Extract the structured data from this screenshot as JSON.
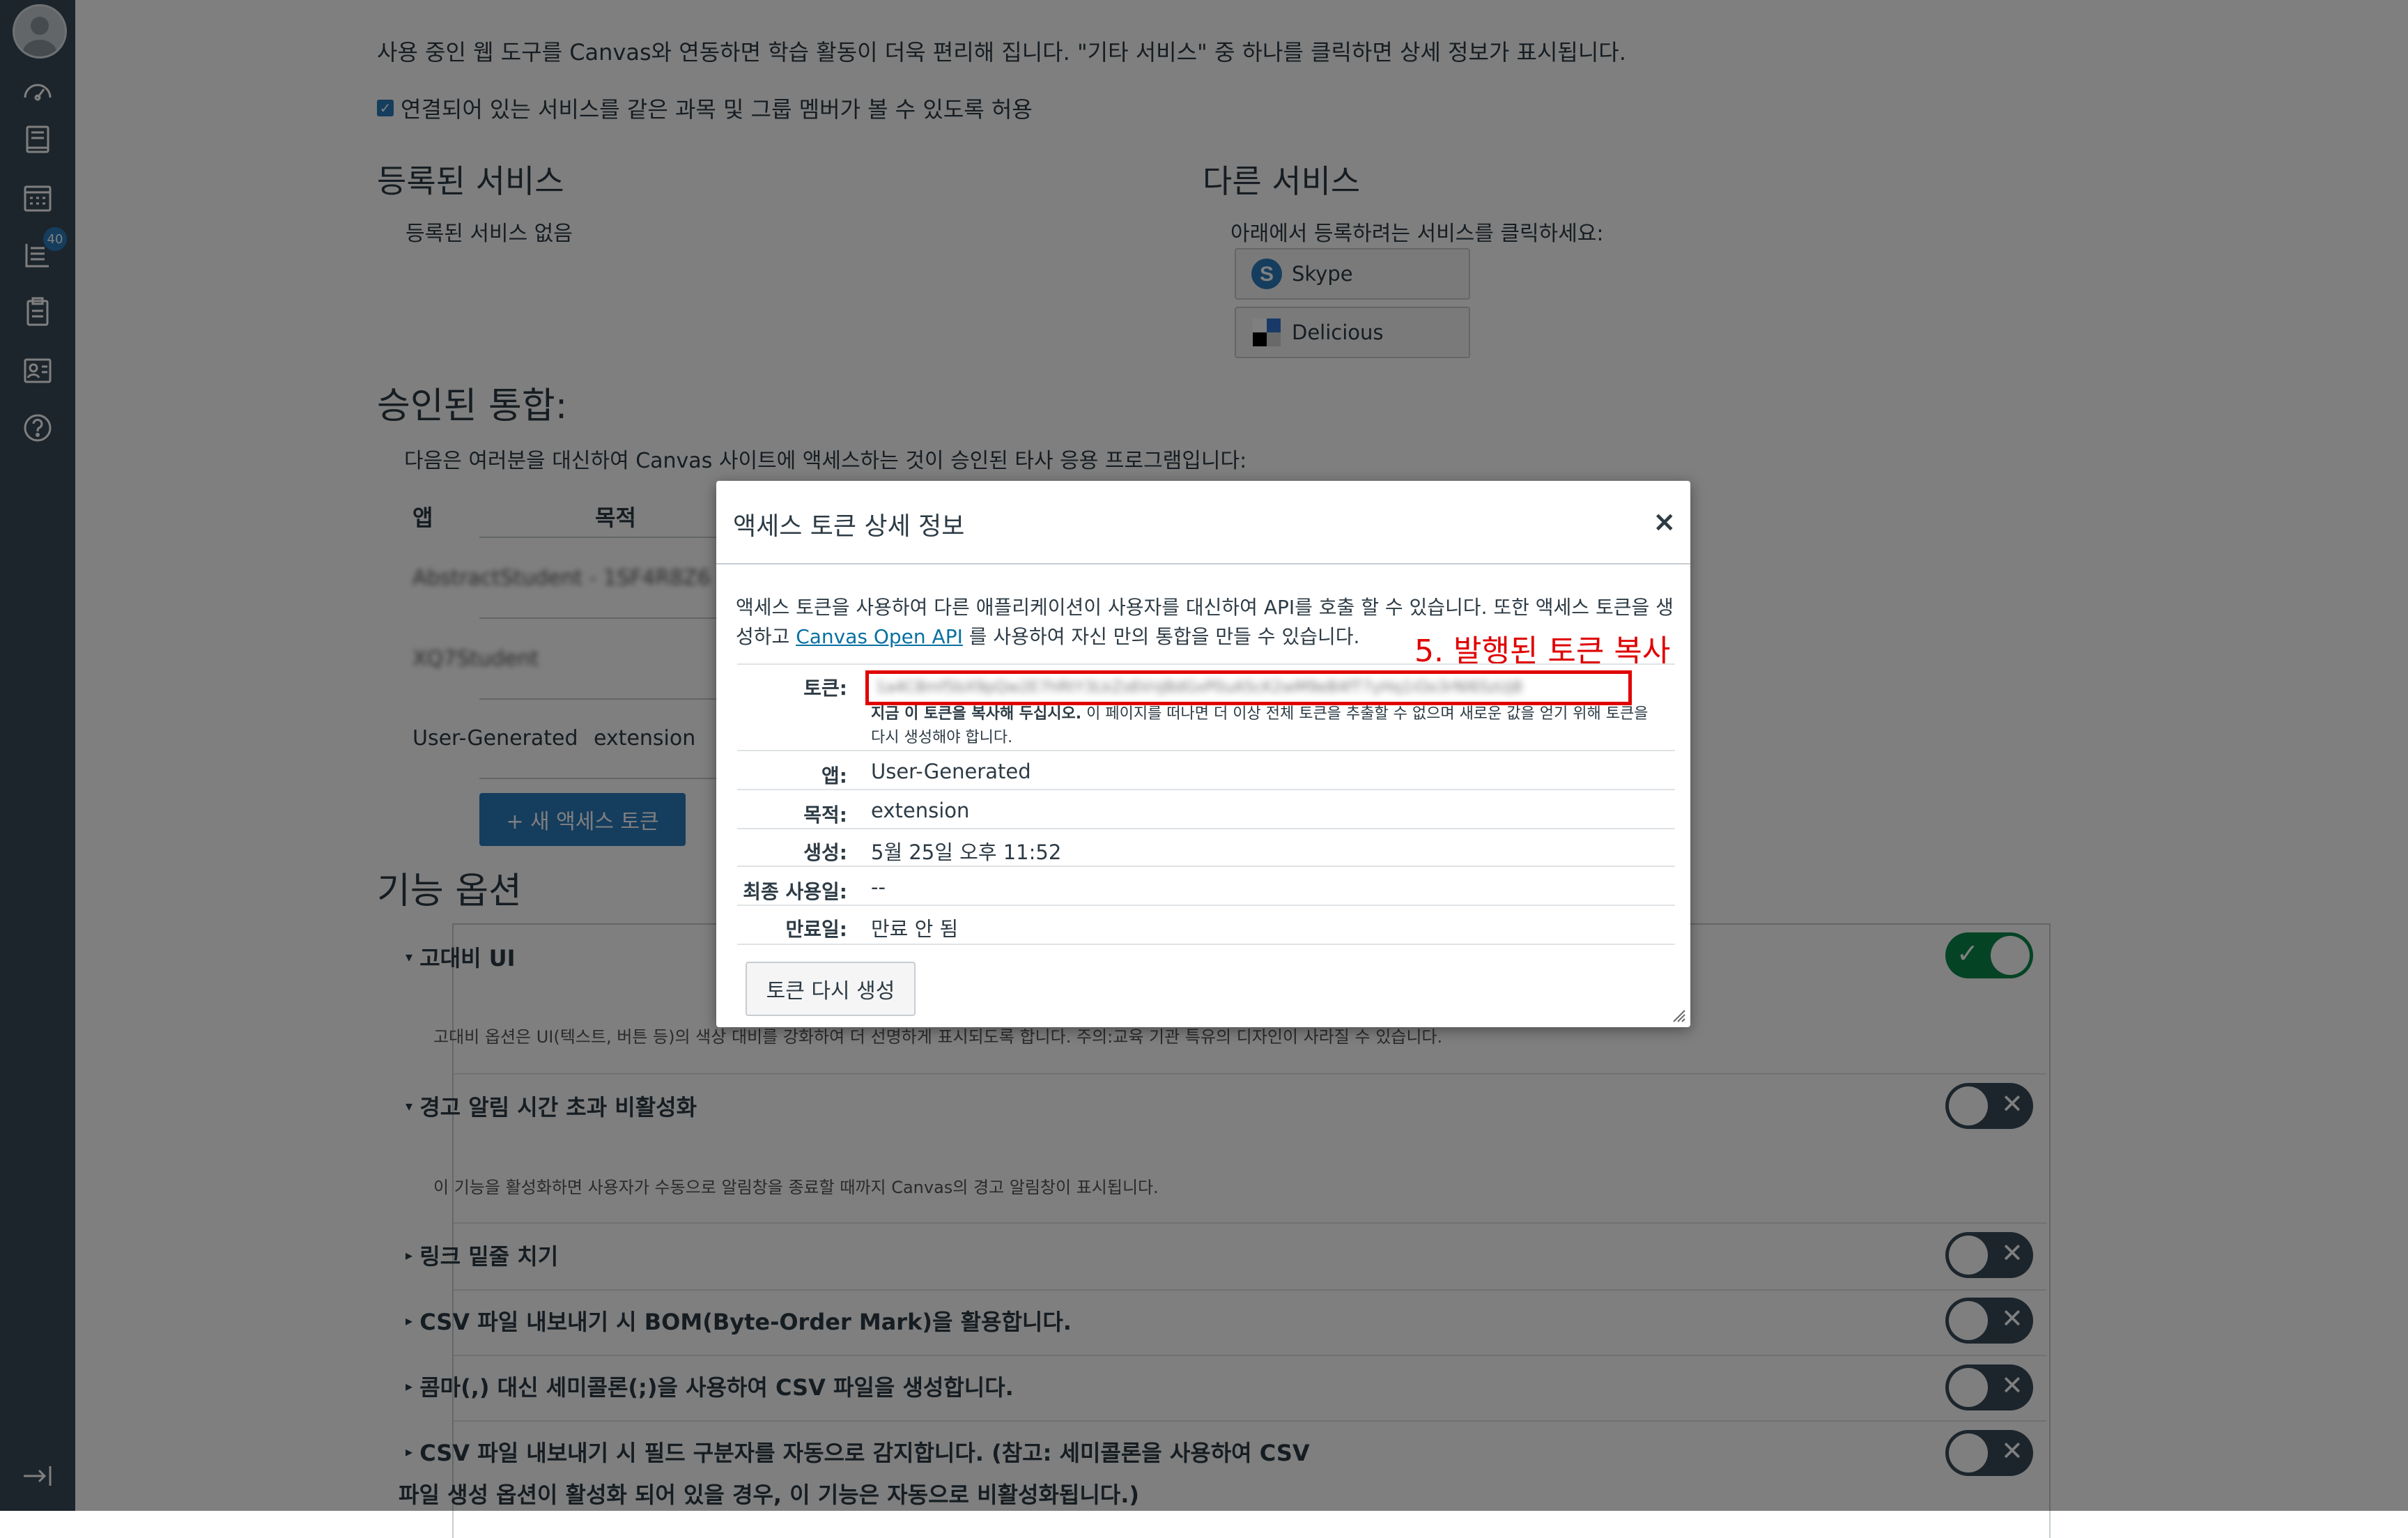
{
  "main": {
    "intro_text": "사용 중인 웹 도구를 Canvas와 연동하면 학습 활동이 더욱 편리해 집니다. \"기타 서비스\" 중 하나를 클릭하면 상세 정보가 표시됩니다.",
    "allow_checkbox_label": "연결되어 있는 서비스를 같은 과목 및 그룹 멤버가 볼 수 있도록 허용",
    "registered_services": {
      "title": "등록된 서비스",
      "empty_text": "등록된 서비스 없음"
    },
    "other_services": {
      "title": "다른 서비스",
      "instruction": "아래에서 등록하려는 서비스를 클릭하세요:",
      "items": [
        "Skype",
        "Delicious"
      ]
    },
    "approved": {
      "title": "승인된 통합:",
      "description": "다음은 여러분을 대신하여 Canvas 사이트에 액세스하는 것이 승인된 타사 응용 프로그램입니다:",
      "columns": [
        "앱",
        "목적"
      ],
      "rows": [
        {
          "app": "AbstractStudent - 1SF4R8Z6",
          "purpose": ""
        },
        {
          "app": "XQ7Student",
          "purpose": ""
        },
        {
          "app": "User-Generated",
          "purpose": "extension"
        }
      ],
      "new_token_button": "+ 새 액세스 토큰"
    },
    "features": {
      "title": "기능 옵션",
      "items": [
        {
          "label": "고대비 UI",
          "description": "고대비 옵션은 UI(텍스트, 버튼 등)의 색상 대비를 강화하여 더 선명하게 표시되도록 합니다. 주의:교육 기관 특유의 디자인이 사라질 수 있습니다.",
          "enabled": true
        },
        {
          "label": "경고 알림 시간 초과 비활성화",
          "description": "이 기능을 활성화하면 사용자가 수동으로 알림창을 종료할 때까지 Canvas의 경고 알림창이 표시됩니다.",
          "enabled": false
        },
        {
          "label": "링크 밑줄 치기",
          "description": "",
          "enabled": false
        },
        {
          "label": "CSV 파일 내보내기 시 BOM(Byte-Order Mark)을 활용합니다.",
          "description": "",
          "enabled": false
        },
        {
          "label": "콤마(,) 대신 세미콜론(;)을 사용하여 CSV 파일을 생성합니다.",
          "description": "",
          "enabled": false
        },
        {
          "label": "CSV 파일 내보내기 시 필드 구분자를 자동으로 감지합니다. (참고: 세미콜론을 사용하여 CSV",
          "label_line2": "파일 생성 옵션이 활성화 되어 있을 경우, 이 기능은 자동으로 비활성화됩니다.)",
          "description": "",
          "enabled": false
        }
      ]
    }
  },
  "sidebar": {
    "badge_count": "40"
  },
  "modal": {
    "title": "액세스 토큰 상세 정보",
    "close_label": "×",
    "desc_line1": "액세스 토큰을 사용하여 다른 애플리케이션이 사용자를 대신하여 API를 호출 할 수 있습니다. 또한 액세스 토큰을 생",
    "desc_line2_prefix": "성하고",
    "desc_link": "Canvas Open API",
    "desc_line2_suffix": "를 사용하여 자신 만의 통합을 만들 수 있습니다.",
    "annotation": "5. 발행된 토큰 복사",
    "token_label": "토큰:",
    "token_value": "1a4C8mf5bX9pQw2E7hRtY3LkZs6VnJ8dGxP0uA5cK2wM9eB4fT7yHq1iOo3rNl6SzUj8",
    "warning_bold": "지금 이 토큰을 복사해 두십시오.",
    "warning_text": " 이 페이지를 떠나면 더 이상 전체 토큰을 추출할 수 없으며 새로운 값을 얻기 위해 토큰을 다시 생성해야 합니다.",
    "fields": [
      {
        "label": "앱:",
        "value": "User-Generated"
      },
      {
        "label": "목적:",
        "value": "extension"
      },
      {
        "label": "생성:",
        "value": "5월 25일 오후 11:52"
      },
      {
        "label": "최종 사용일:",
        "value": "--"
      },
      {
        "label": "만료일:",
        "value": "만료 안 됨"
      }
    ],
    "regenerate_button": "토큰 다시 생성"
  }
}
